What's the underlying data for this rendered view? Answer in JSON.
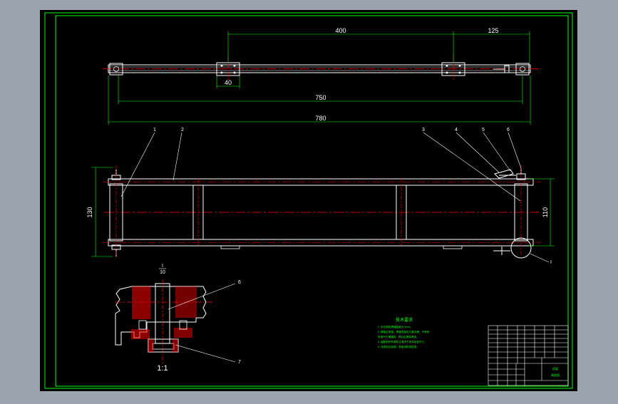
{
  "colors": {
    "background_frame": "#9aa3ae",
    "canvas": "#000000",
    "border": "#00ff00",
    "geometry": "#ffffff",
    "centerline": "#ff0000",
    "dimension": "#00ff00",
    "hatch": "#ff0000",
    "text": "#ffffff"
  },
  "top_view": {
    "dims": {
      "d400": "400",
      "d125": "125",
      "d40": "40",
      "d750": "750",
      "d780": "780"
    }
  },
  "front_view": {
    "dims": {
      "d130": "130",
      "d110": "110"
    },
    "callouts": [
      "1",
      "2",
      "3",
      "4",
      "5",
      "6",
      "I"
    ]
  },
  "detail": {
    "label_top": "I",
    "label_bottom": "10",
    "scale_note": "1:1",
    "callouts": [
      "6",
      "7"
    ]
  },
  "notes": {
    "title": "技术要求",
    "lines": [
      "1. 未注明的焊缝高度为 5mm。",
      "2. 焊接应牢固，焊缝表面应平整光滑，不得有",
      "   夹渣气孔等缺陷，焊后应清除焊渣。",
      "3. 装配前所有零件应清洗干净并检查尺寸。",
      "4. 涂漆前应除锈，表面涂防锈底漆。"
    ]
  },
  "title_block": {
    "drawing_name": "机架",
    "drawing_code": "装配图"
  }
}
